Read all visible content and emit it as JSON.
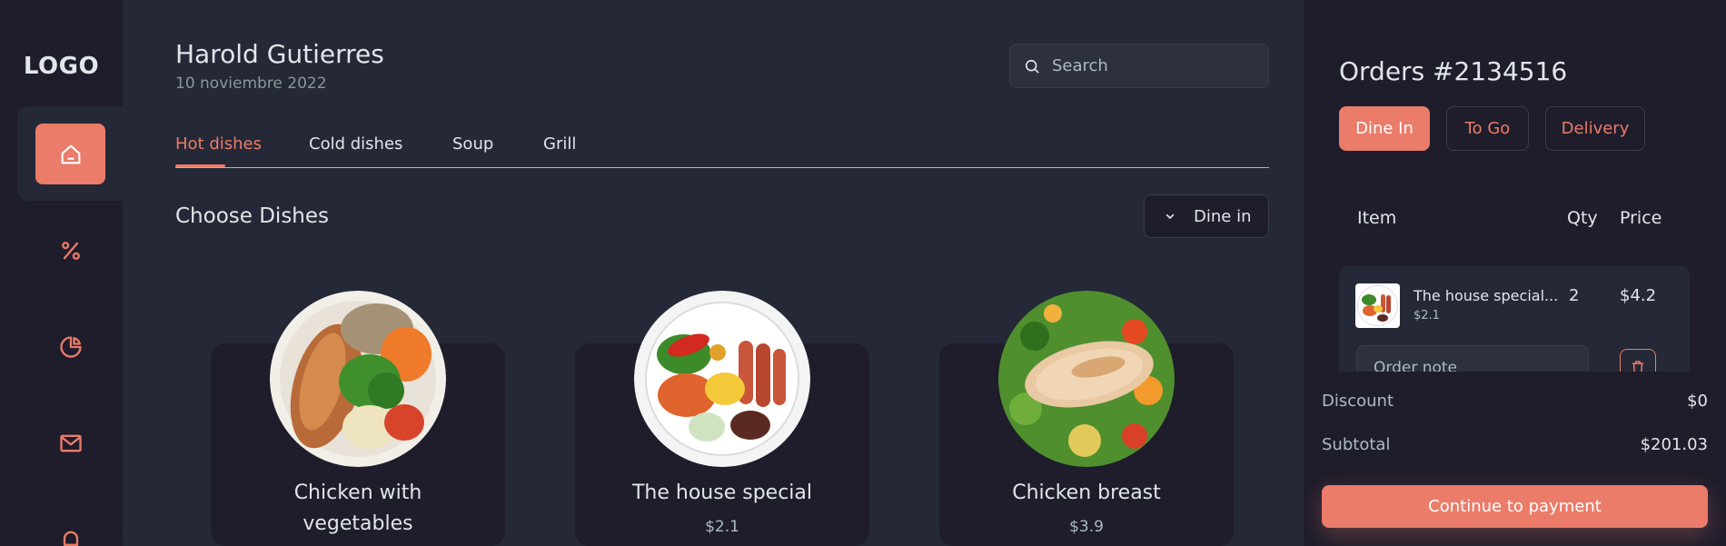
{
  "sidebar": {
    "logo": "LOGO",
    "items": [
      {
        "icon": "home-icon"
      },
      {
        "icon": "discount-icon"
      },
      {
        "icon": "dashboard-icon"
      },
      {
        "icon": "message-icon"
      },
      {
        "icon": "notification-icon"
      }
    ]
  },
  "header": {
    "user_name": "Harold Gutierres",
    "date": "10 noviembre 2022",
    "search_placeholder": "Search"
  },
  "tabs": [
    {
      "label": "Hot dishes",
      "active": true
    },
    {
      "label": "Cold dishes",
      "active": false
    },
    {
      "label": "Soup",
      "active": false
    },
    {
      "label": "Grill",
      "active": false
    }
  ],
  "section": {
    "title": "Choose Dishes",
    "dine_option": "Dine in"
  },
  "dishes": [
    {
      "name_line1": "Chicken with",
      "name_line2": "vegetables",
      "price": ""
    },
    {
      "name_line1": "The house special",
      "name_line2": "",
      "price": "$2.1"
    },
    {
      "name_line1": "Chicken breast",
      "name_line2": "",
      "price": "$3.9"
    }
  ],
  "orders": {
    "title": "Orders #2134516",
    "types": [
      {
        "label": "Dine In",
        "active": true
      },
      {
        "label": "To Go",
        "active": false
      },
      {
        "label": "Delivery",
        "active": false
      }
    ],
    "columns": {
      "item": "Item",
      "qty": "Qty",
      "price": "Price"
    },
    "items": [
      {
        "name": "The house special...",
        "unit_price": "$2.1",
        "qty": "2",
        "total": "$4.2",
        "note_placeholder": "Order note"
      }
    ],
    "summary": {
      "discount_label": "Discount",
      "discount_value": "$0",
      "subtotal_label": "Subtotal",
      "subtotal_value": "$201.03"
    },
    "continue_label": "Continue to payment"
  },
  "colors": {
    "accent": "#ea7c69",
    "background": "#252836",
    "panel": "#1f1d2b"
  }
}
